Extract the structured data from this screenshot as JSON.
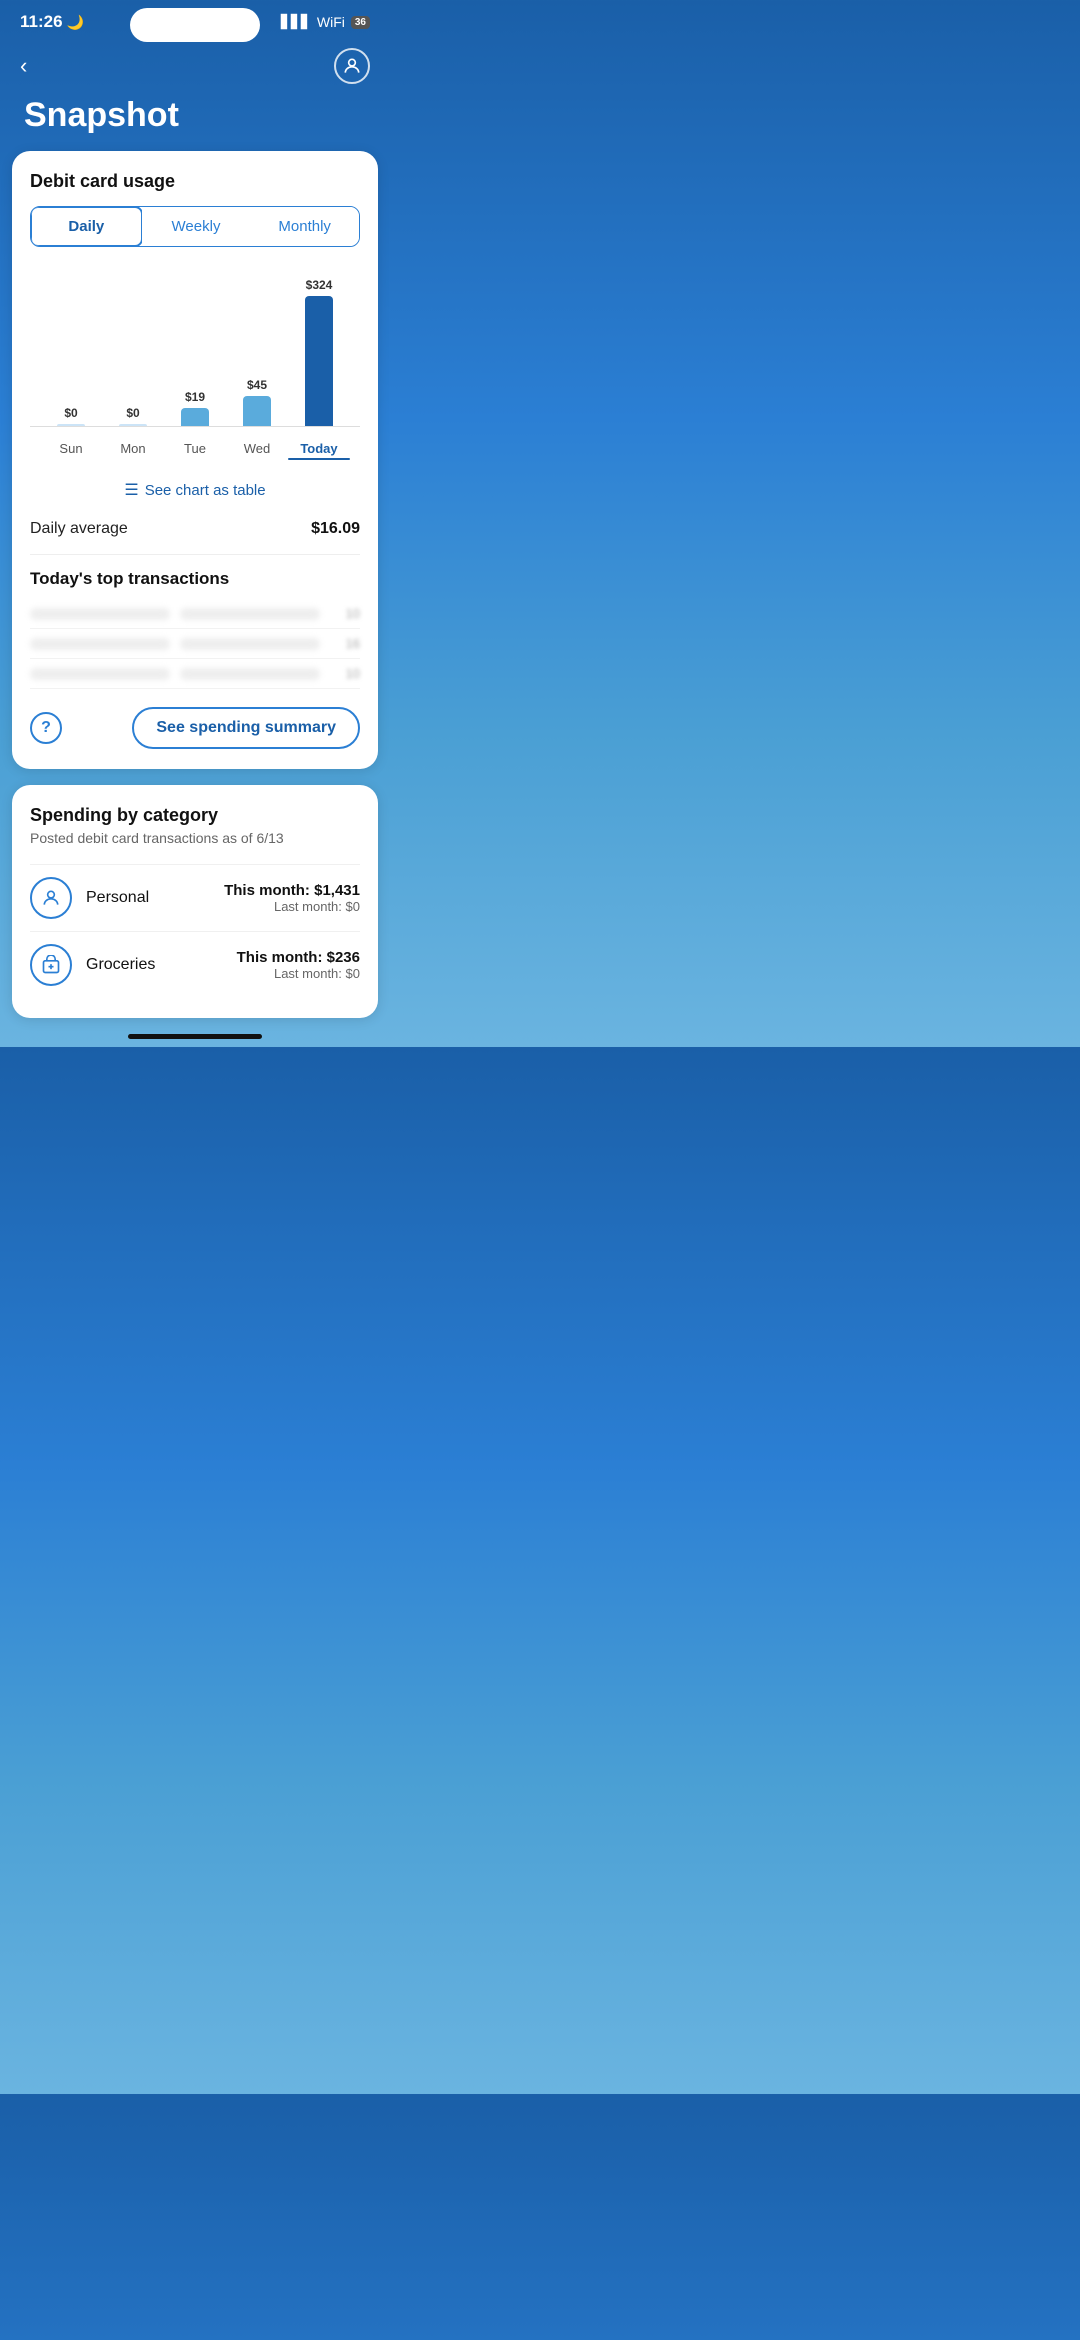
{
  "status_bar": {
    "time": "11:26",
    "moon_icon": "🌙",
    "battery_label": "36"
  },
  "nav": {
    "back_label": "‹",
    "page_title": "Snapshot"
  },
  "debit_card_card": {
    "title": "Debit card usage",
    "tabs": [
      {
        "label": "Daily",
        "active": true
      },
      {
        "label": "Weekly",
        "active": false
      },
      {
        "label": "Monthly",
        "active": false
      }
    ],
    "chart": {
      "bars": [
        {
          "label": "Sun",
          "amount": "$0",
          "height": 2,
          "color": "#cce4f7"
        },
        {
          "label": "Mon",
          "amount": "$0",
          "height": 2,
          "color": "#cce4f7"
        },
        {
          "label": "Tue",
          "amount": "$19",
          "height": 18,
          "color": "#5aabdc"
        },
        {
          "label": "Wed",
          "amount": "$45",
          "height": 30,
          "color": "#5aabdc"
        },
        {
          "label": "Today",
          "amount": "$324",
          "height": 130,
          "color": "#1a5fa8",
          "is_today": true
        }
      ]
    },
    "see_chart_label": "See chart as table",
    "daily_average_label": "Daily average",
    "daily_average_value": "$16.09",
    "top_transactions_title": "Today's top transactions",
    "transactions": [
      {
        "text_blur": true,
        "amount": "10"
      },
      {
        "text_blur": true,
        "amount": "16"
      },
      {
        "text_blur": true,
        "amount": "10"
      }
    ],
    "help_icon": "?",
    "see_spending_summary_label": "See spending summary"
  },
  "spending_category_card": {
    "title": "Spending by category",
    "subtitle": "Posted debit card transactions as of 6/13",
    "categories": [
      {
        "icon": "👤",
        "name": "Personal",
        "this_month_label": "This month:",
        "this_month_value": "$1,431",
        "last_month_label": "Last month:",
        "last_month_value": "$0"
      },
      {
        "icon": "🛍",
        "name": "Groceries",
        "this_month_label": "This month:",
        "this_month_value": "$236",
        "last_month_label": "Last month:",
        "last_month_value": "$0"
      }
    ]
  }
}
